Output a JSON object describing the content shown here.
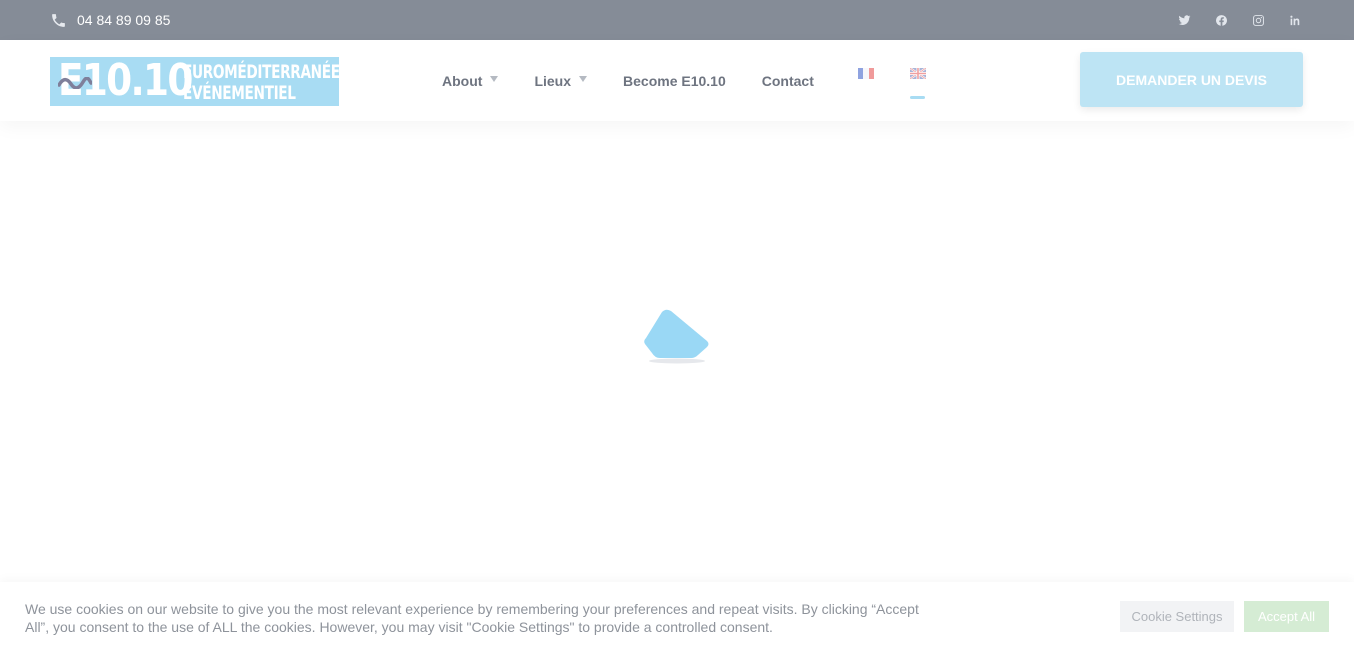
{
  "topbar": {
    "phone": "04 84 89 09 85",
    "socials": [
      "twitter-icon",
      "facebook-icon",
      "instagram-icon",
      "linkedin-icon"
    ]
  },
  "header": {
    "logo": {
      "big": "E10.10",
      "line1": "EUROMÉDITERRANÉE",
      "line2": "ÉVÉNEMENTIEL"
    },
    "nav": [
      {
        "label": "About",
        "has_dropdown": true
      },
      {
        "label": "Lieux",
        "has_dropdown": true
      },
      {
        "label": "Become E10.10",
        "has_dropdown": false
      },
      {
        "label": "Contact",
        "has_dropdown": false
      }
    ],
    "languages": [
      "fr-flag-icon",
      "en-flag-icon"
    ],
    "cta_label": "DEMANDER UN DEVIS"
  },
  "cookie": {
    "text": "We use cookies on our website to give you the most relevant experience by remembering your preferences and repeat visits. By clicking “Accept All”, you consent to the use of ALL the cookies. However, you may visit \"Cookie Settings\" to provide a controlled consent.",
    "settings_label": "Cookie Settings",
    "accept_label": "Accept All"
  },
  "colors": {
    "topbar": "#858c97",
    "accent": "#a8dcf3",
    "loader": "#9ad8f5",
    "accept": "#d5ecd4"
  }
}
